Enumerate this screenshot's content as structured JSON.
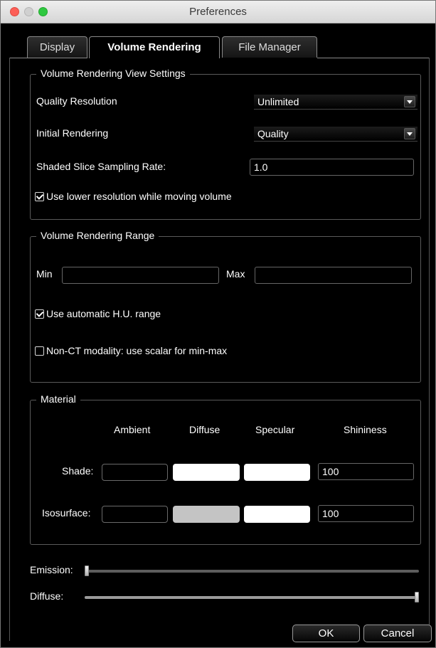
{
  "window": {
    "title": "Preferences"
  },
  "tabs": [
    {
      "label": "Display",
      "active": false
    },
    {
      "label": "Volume Rendering",
      "active": true
    },
    {
      "label": "File Manager",
      "active": false
    }
  ],
  "view_settings": {
    "legend": "Volume Rendering View Settings",
    "quality_resolution": {
      "label": "Quality Resolution",
      "value": "Unlimited"
    },
    "initial_rendering": {
      "label": "Initial Rendering",
      "value": "Quality"
    },
    "shaded_slice": {
      "label": "Shaded Slice Sampling Rate:",
      "value": "1.0"
    },
    "lower_resolution": {
      "label": "Use lower resolution while moving volume",
      "checked": true
    }
  },
  "range": {
    "legend": "Volume Rendering Range",
    "min_label": "Min",
    "min_value": "",
    "max_label": "Max",
    "max_value": "",
    "auto_hu": {
      "label": "Use automatic H.U. range",
      "checked": true
    },
    "non_ct": {
      "label": "Non-CT modality: use scalar for min-max",
      "checked": false
    }
  },
  "material": {
    "legend": "Material",
    "columns": [
      "Ambient",
      "Diffuse",
      "Specular",
      "Shininess"
    ],
    "rows": [
      {
        "label": "Shade:",
        "ambient": "#000000",
        "diffuse": "#ffffff",
        "specular": "#ffffff",
        "shininess": "100"
      },
      {
        "label": "Isosurface:",
        "ambient": "#000000",
        "diffuse": "#c4c4c4",
        "specular": "#ffffff",
        "shininess": "100"
      }
    ]
  },
  "sliders": {
    "emission": {
      "label": "Emission:",
      "value": 0.0
    },
    "diffuse": {
      "label": "Diffuse:",
      "value": 1.0
    }
  },
  "buttons": {
    "ok": "OK",
    "cancel": "Cancel"
  }
}
